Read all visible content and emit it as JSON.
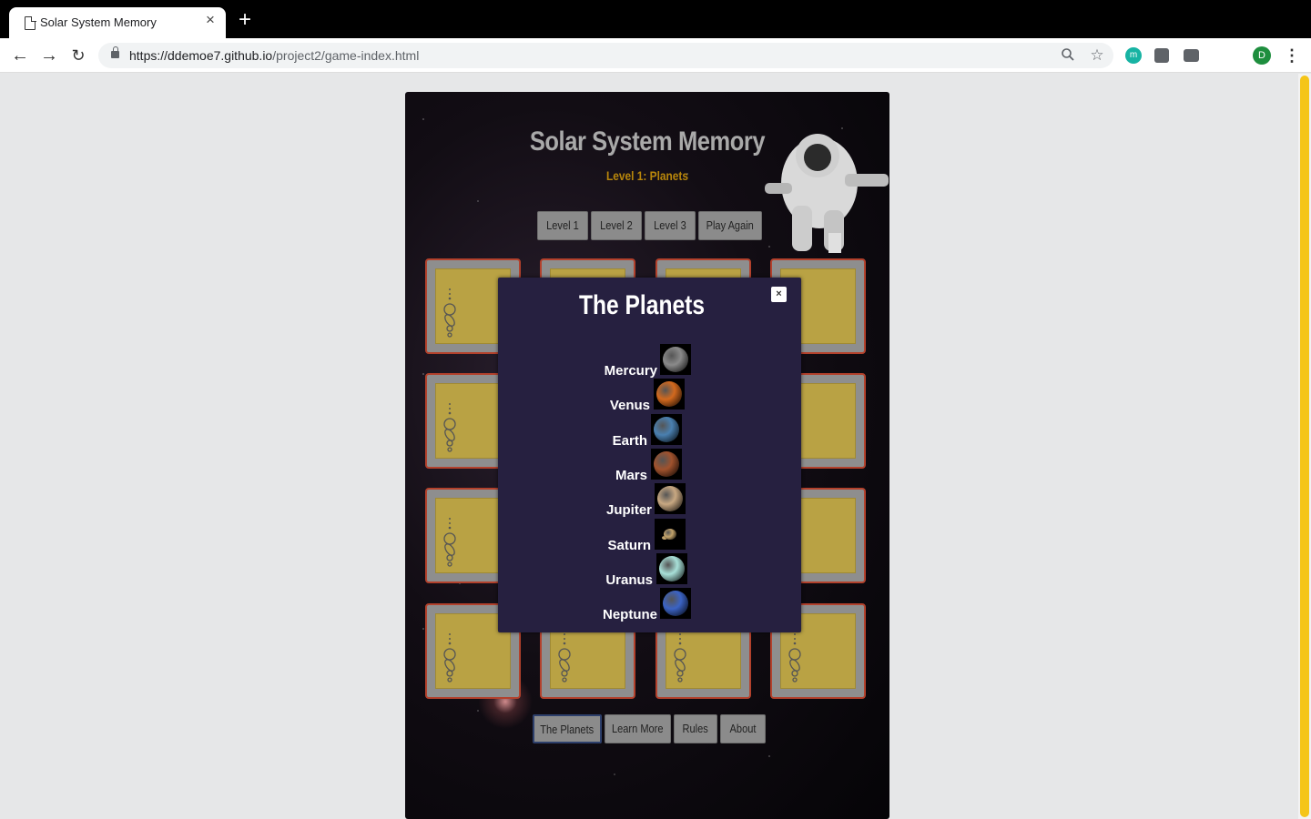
{
  "browser": {
    "tab_title": "Solar System Memory",
    "url_host": "https://ddemoe7.github.io",
    "url_path": "/project2/game-index.html",
    "avatar_letter": "D",
    "ext_m_letter": "m"
  },
  "game": {
    "title": "Solar System Memory",
    "subtitle": "Level 1: Planets",
    "level_buttons": [
      "Level 1",
      "Level 2",
      "Level 3",
      "Play Again"
    ],
    "footer_buttons": [
      "The Planets",
      "Learn More",
      "Rules",
      "About"
    ]
  },
  "modal": {
    "title": "The Planets",
    "close_label": "×",
    "planets": [
      {
        "name": "Mercury",
        "color": "#8a8a8a"
      },
      {
        "name": "Venus",
        "color": "#d2691e"
      },
      {
        "name": "Earth",
        "color": "#4a80b0"
      },
      {
        "name": "Mars",
        "color": "#a0522d"
      },
      {
        "name": "Jupiter",
        "color": "#c8a882"
      },
      {
        "name": "Saturn",
        "color": "#c2a36b"
      },
      {
        "name": "Uranus",
        "color": "#a8e0d8"
      },
      {
        "name": "Neptune",
        "color": "#3b63c4"
      }
    ]
  },
  "colors": {
    "card_border": "#b3412c",
    "card_face": "#b9a244",
    "modal_bg": "#262040",
    "subtitle": "#b8860b",
    "scroll_thumb": "#f5c518"
  }
}
